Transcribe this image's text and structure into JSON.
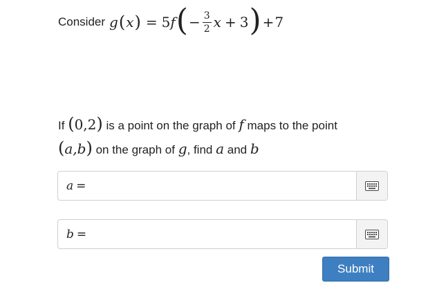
{
  "problem": {
    "prefix": "Consider",
    "lhs_func": "g",
    "lhs_var": "x",
    "equals": "=",
    "coef": "5",
    "inner_func": "f",
    "minus": "−",
    "frac_num": "3",
    "frac_den": "2",
    "inner_var": "x",
    "plus_inner": "+",
    "inner_const": "3",
    "plus_outer": "+",
    "outer_const": "7"
  },
  "question": {
    "if_text": "If",
    "point_coords": "0,2",
    "middle_text": "is a point on the graph of",
    "f_name": "f",
    "maps_text": "maps to the point",
    "ab_coords": "a,b",
    "on_graph_text": "on the graph of",
    "g_name": "g",
    "find_text": ", find",
    "a_var": "a",
    "and_text": "and",
    "b_var": "b"
  },
  "answers": [
    {
      "variable": "a",
      "equals": "=",
      "value": ""
    },
    {
      "variable": "b",
      "equals": "=",
      "value": ""
    }
  ],
  "icons": {
    "keyboard": "keyboard-icon"
  },
  "submit": {
    "label": "Submit"
  },
  "colors": {
    "submit_bg": "#3e7fc1",
    "input_border": "#cfcfcf",
    "keyboard_bg": "#f3f3f3"
  }
}
